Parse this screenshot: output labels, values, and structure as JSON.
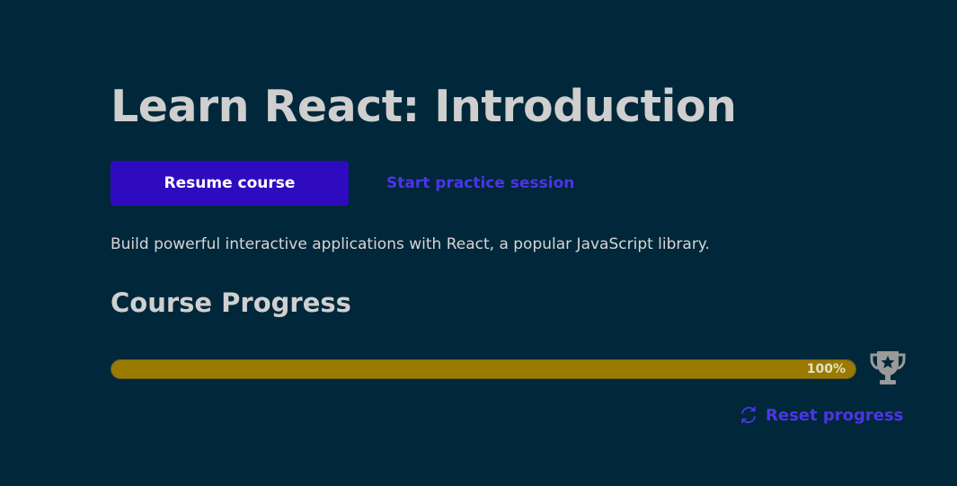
{
  "course": {
    "title": "Learn React: Introduction",
    "description": "Build powerful interactive applications with React, a popular JavaScript library."
  },
  "actions": {
    "resume_label": "Resume course",
    "practice_label": "Start practice session"
  },
  "progress": {
    "heading": "Course Progress",
    "percent": 100,
    "percent_label": "100%",
    "reset_label": "Reset progress"
  },
  "icons": {
    "trophy": "trophy-icon",
    "reset": "refresh-icon"
  },
  "colors": {
    "background": "#01273a",
    "primary_button": "#2f0bbf",
    "link": "#4c35e6",
    "progress_fill": "#9a7b00",
    "trophy": "#9a9a9a"
  }
}
